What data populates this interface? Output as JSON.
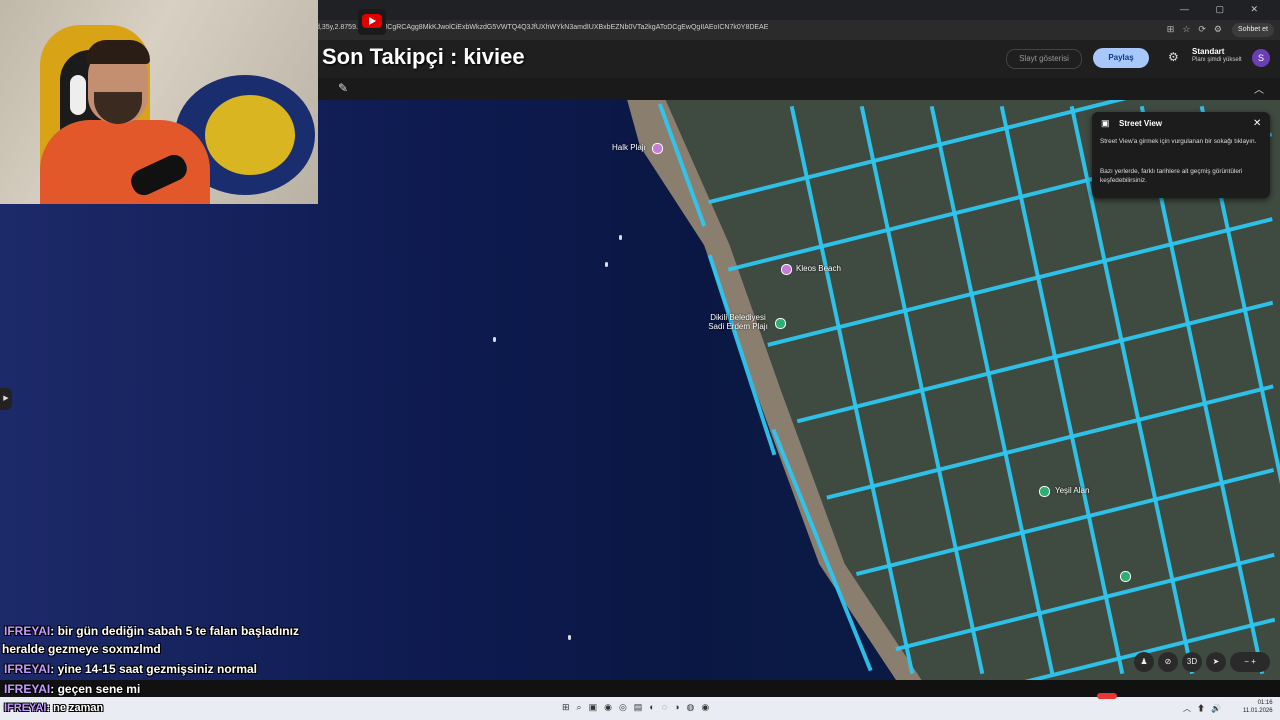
{
  "browser": {
    "url": "d,35y,2.8759...4/data=!CgRCAgg8MkKJwolCiExbWkzdG5VWTQ4Q3JfUXhWYkN3amdIUXBxbEZNb0VTa2kgAToDCgEwQgIIAEoICN7k0Y8DEAE",
    "chat_button": "Sohbet et"
  },
  "overlay": {
    "last_follower": "Son Takipçi : kiviee"
  },
  "maps_header": {
    "slideshow": "Slayt gösterisi",
    "share": "Paylaş",
    "plan_name": "Standart",
    "plan_upgrade": "Planı şimdi yükselt",
    "avatar_letter": "S"
  },
  "street_view": {
    "title": "Street View",
    "line1": "Street View'a girmek için vurgulanan bir sokağı tıklayın.",
    "line2": "Bazı yerlerde, farklı tarihlere ait geçmiş görüntüleri keşfedebilirsiniz."
  },
  "map": {
    "places": [
      {
        "name": "Halk Plajı",
        "color": "#c77ad6"
      },
      {
        "name": "Kleos Beach",
        "color": "#c77ad6"
      },
      {
        "name": "Dikili Belediyesi Sadi Erdem Plajı",
        "color": "#2fae76"
      },
      {
        "name": "Yeşil Alan",
        "color": "#2fae76"
      }
    ],
    "controls": {
      "three_d": "3D"
    }
  },
  "chat": [
    {
      "user": "IFREYAI",
      "text": ": bir gün dediğin sabah 5 te falan başladınız"
    },
    {
      "user": "",
      "text": "heralde gezmeye soxmzlmd"
    },
    {
      "user": "IFREYAI",
      "text": ": yine 14-15 saat gezmişsiniz normal"
    },
    {
      "user": "IFREYAI",
      "text": ": geçen sene mi"
    },
    {
      "user": "IFREYAI",
      "text": ": ne zaman"
    }
  ],
  "taskbar": {
    "time": "01:16",
    "date": "11.01.2026"
  }
}
